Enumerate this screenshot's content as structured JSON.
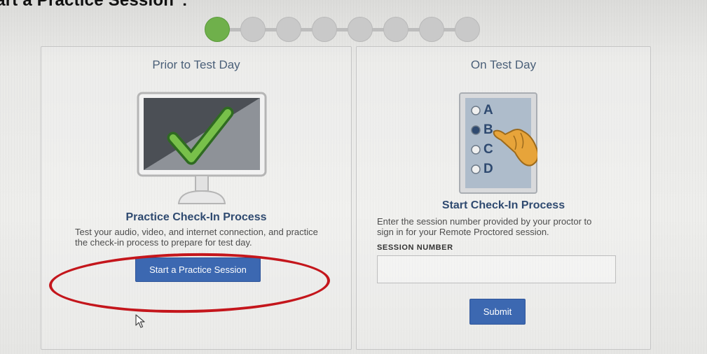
{
  "caption": "tart a Practice Session\":",
  "progress": {
    "total_steps": 8,
    "current_step": 1
  },
  "prior": {
    "title": "Prior to Test Day",
    "heading": "Practice Check-In Process",
    "desc_line1": "Test your audio, video, and internet connection, and practice",
    "desc_line2": "the check-in process to prepare for test day.",
    "button": "Start a Practice Session",
    "icon": "monitor-checkmark-icon"
  },
  "test_day": {
    "title": "On Test Day",
    "heading": "Start Check-In Process",
    "desc_line1": "Enter the session number provided by your proctor to",
    "desc_line2": "sign in for your Remote Proctored session.",
    "field_label": "SESSION NUMBER",
    "field_value": "",
    "field_placeholder": "",
    "button": "Submit",
    "icon": "multiple-choice-pointer-icon",
    "options": [
      "A",
      "B",
      "C",
      "D"
    ],
    "selected_option": "B"
  },
  "colors": {
    "primary_button": "#3c68b1",
    "active_step": "#6fb04b",
    "inactive_step": "#c9c9c9",
    "heading": "#2f4a70",
    "annotation": "#c4161c"
  }
}
